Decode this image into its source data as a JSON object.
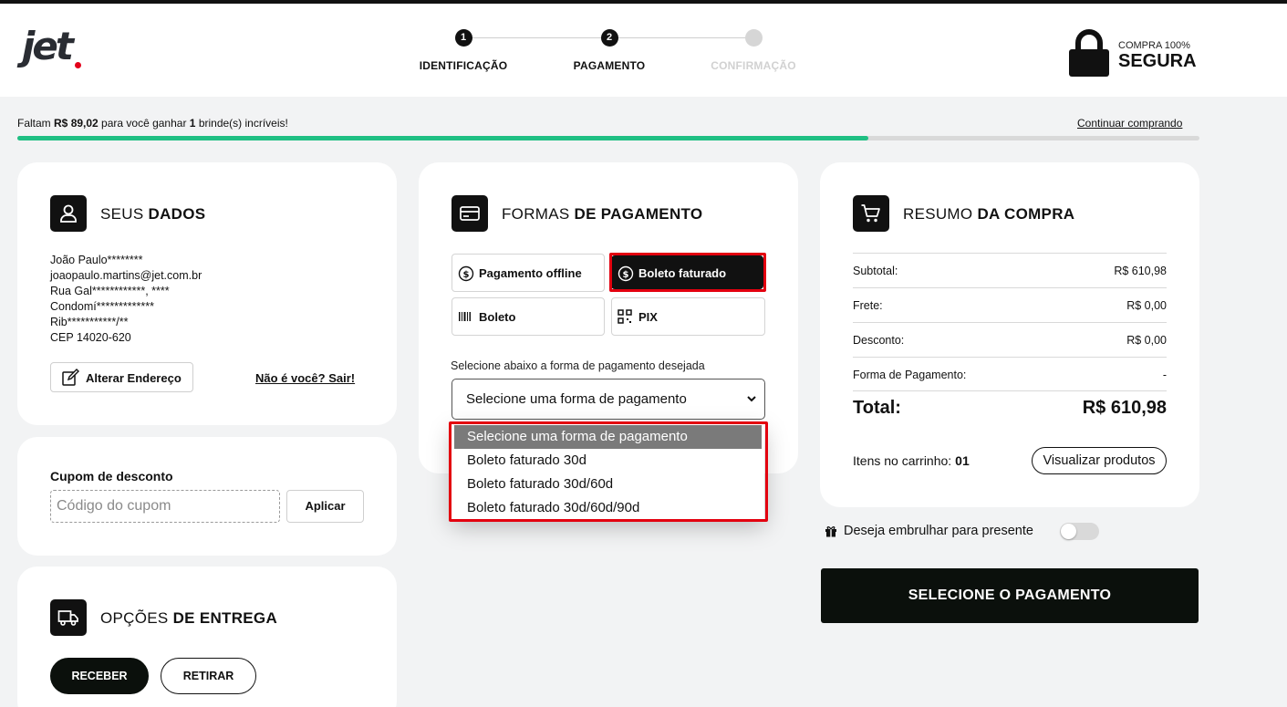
{
  "header": {
    "logo_text": "jet",
    "steps": [
      {
        "number": "1",
        "label": "IDENTIFICAÇÃO"
      },
      {
        "number": "2",
        "label": "PAGAMENTO"
      },
      {
        "number": "",
        "label": "CONFIRMAÇÃO"
      }
    ],
    "secure_small": "COMPRA 100%",
    "secure_big": "SEGURA"
  },
  "gift_bar": {
    "text_1": "Faltam ",
    "amount": "R$ 89,02",
    "text_2": " para você ganhar ",
    "count": "1",
    "text_3": " brinde(s) incríveis!",
    "continue_link": "Continuar comprando",
    "progress_fraction": 0.72
  },
  "user": {
    "title_light": "SEUS ",
    "title_bold": "DADOS",
    "lines": [
      "João Paulo********",
      "joaopaulo.martins@jet.com.br",
      "Rua Gal************, ****",
      "Condomí*************",
      "Rib***********/**",
      "CEP 14020-620"
    ],
    "change_address": "Alterar Endereço",
    "not_you": "Não é você? Sair!"
  },
  "coupon": {
    "title": "Cupom de desconto",
    "placeholder": "Código do cupom",
    "apply": "Aplicar"
  },
  "delivery": {
    "title_light": "OPÇÕES ",
    "title_bold": "DE ENTREGA",
    "receive": "RECEBER",
    "pickup": "RETIRAR"
  },
  "payment": {
    "title_light": "FORMAS ",
    "title_bold": "DE PAGAMENTO",
    "methods": [
      "Pagamento offline",
      "Boleto faturado",
      "Boleto",
      "PIX"
    ],
    "select_hint": "Selecione abaixo a forma de pagamento desejada",
    "select_value": "Selecione uma forma de pagamento",
    "options": [
      "Selecione uma forma de pagamento",
      "Boleto faturado 30d",
      "Boleto faturado 30d/60d",
      "Boleto faturado 30d/60d/90d"
    ]
  },
  "summary": {
    "title_light": "RESUMO ",
    "title_bold": "DA COMPRA",
    "subtotal_label": "Subtotal:",
    "subtotal_value": "R$ 610,98",
    "shipping_label": "Frete:",
    "shipping_value": "R$ 0,00",
    "discount_label": "Desconto:",
    "discount_value": "R$ 0,00",
    "payment_label": "Forma de Pagamento:",
    "payment_value": "-",
    "total_label": "Total:",
    "total_value": "R$ 610,98",
    "items_label": "Itens no carrinho:",
    "items_value": "01",
    "view_products": "Visualizar produtos"
  },
  "gift_wrap": "Deseja embrulhar para presente",
  "cta": "SELECIONE O PAGAMENTO",
  "colors": {
    "accent_red": "#e3000f",
    "progress_green": "#1fbf83",
    "dark": "#0b100c"
  }
}
